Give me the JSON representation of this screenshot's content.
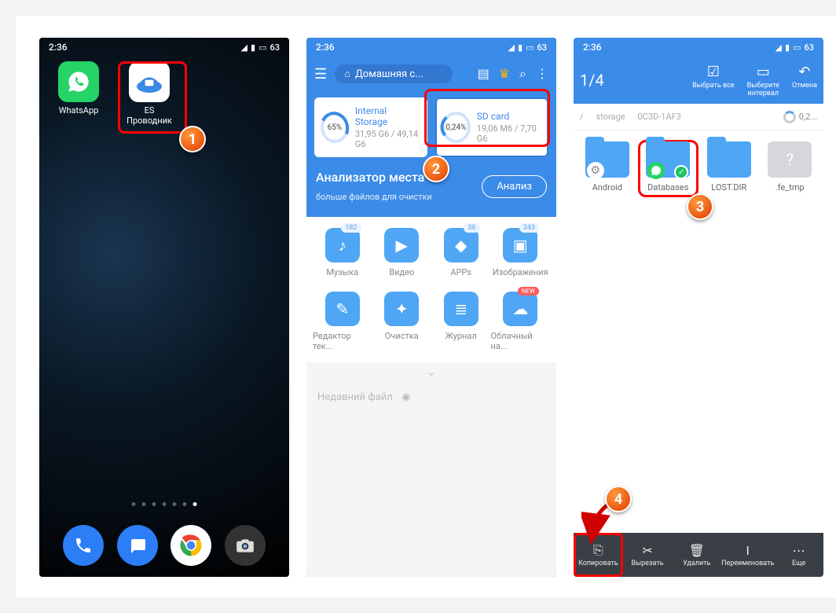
{
  "status": {
    "time": "2:36",
    "battery": "63"
  },
  "phone1": {
    "apps": [
      {
        "label": "WhatsApp"
      },
      {
        "label": "ES\nПроводник"
      }
    ]
  },
  "phone2": {
    "location": "Домашняя с...",
    "storage": {
      "internal": {
        "name": "Internal Storage",
        "percent": "65%",
        "detail": "31,95 G6 / 49,14 G6"
      },
      "sd": {
        "name": "SD card",
        "percent": "0,24%",
        "detail": "19,06 M6 / 7,70 G6"
      }
    },
    "analyzer": {
      "title": "Анализатор места",
      "subtitle": "больше файлов для очистки",
      "button": "Анализ"
    },
    "cats": [
      {
        "label": "Музыка",
        "badge": "182",
        "icon": "♪"
      },
      {
        "label": "Видео",
        "badge": "",
        "icon": "▶"
      },
      {
        "label": "APPs",
        "badge": "36",
        "icon": "◆"
      },
      {
        "label": "Изображения",
        "badge": "343",
        "icon": "▣"
      },
      {
        "label": "Редактор тек...",
        "badge": "",
        "icon": "✎"
      },
      {
        "label": "Очистка",
        "badge": "",
        "icon": "✦"
      },
      {
        "label": "Журнал",
        "badge": "",
        "icon": "≣"
      },
      {
        "label": "Облачный на...",
        "badge": "NEW",
        "icon": "☁"
      }
    ],
    "recent": "Недавний файл"
  },
  "phone3": {
    "selection_count": "1/4",
    "topActions": [
      {
        "label": "Выбрать все",
        "icon": "☑"
      },
      {
        "label": "Выберите\nинтервал",
        "icon": "▭"
      },
      {
        "label": "Отмена",
        "icon": "↶"
      }
    ],
    "breadcrumb": [
      "/",
      "storage",
      "0C3D-1AF3"
    ],
    "freespace": "0,2...",
    "folders": [
      {
        "label": "Android",
        "overlay": "gear"
      },
      {
        "label": "Databases",
        "overlay": "wa",
        "selected": true,
        "highlight": true
      },
      {
        "label": "LOST.DIR",
        "overlay": ""
      },
      {
        "label": ".fe_tmp",
        "overlay": "unknown"
      }
    ],
    "bottom": [
      {
        "label": "Копировать",
        "icon": "⎘",
        "highlight": true
      },
      {
        "label": "Вырезать",
        "icon": "✂"
      },
      {
        "label": "Удалить",
        "icon": "🗑"
      },
      {
        "label": "Переименовать",
        "icon": "I"
      },
      {
        "label": "Еще",
        "icon": "⋯"
      }
    ]
  },
  "steps": {
    "s1": "1",
    "s2": "2",
    "s3": "3",
    "s4": "4"
  }
}
